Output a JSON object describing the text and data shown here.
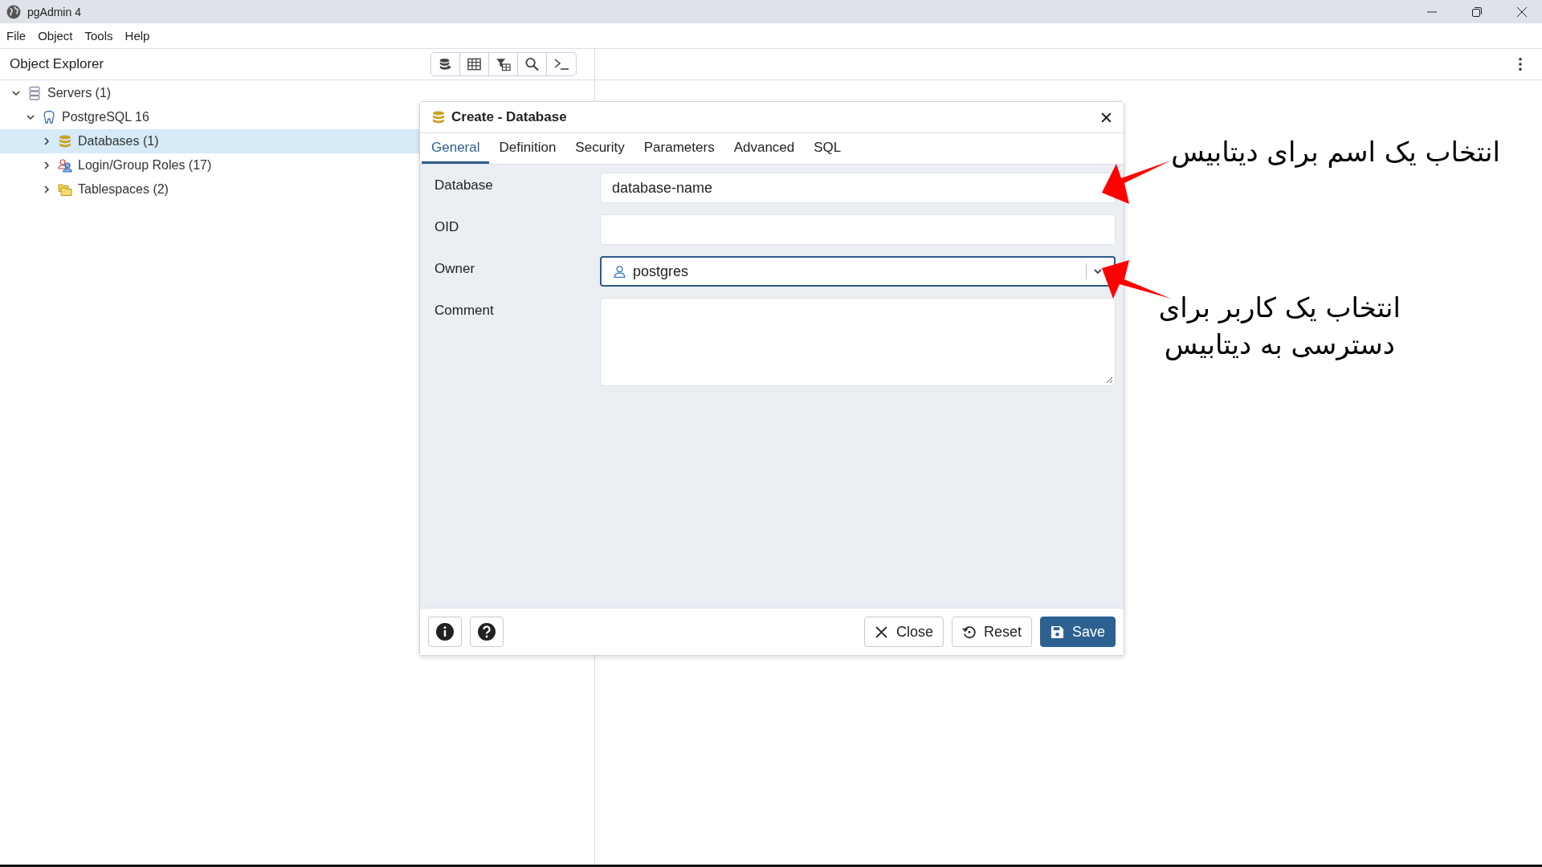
{
  "window": {
    "title": "pgAdmin 4"
  },
  "menu": [
    "File",
    "Object",
    "Tools",
    "Help"
  ],
  "explorer": {
    "title": "Object Explorer",
    "tree": [
      {
        "label": "Servers (1)",
        "kind": "servers",
        "expanded": true,
        "selected": false,
        "children": [
          {
            "label": "PostgreSQL 16",
            "kind": "server",
            "expanded": true,
            "selected": false,
            "children": [
              {
                "label": "Databases (1)",
                "kind": "databases",
                "expanded": false,
                "selected": true
              },
              {
                "label": "Login/Group Roles (17)",
                "kind": "roles",
                "expanded": false,
                "selected": false
              },
              {
                "label": "Tablespaces (2)",
                "kind": "tablespaces",
                "expanded": false,
                "selected": false
              }
            ]
          }
        ]
      }
    ]
  },
  "dialog": {
    "title": "Create - Database",
    "tabs": [
      {
        "label": "General",
        "selected": true
      },
      {
        "label": "Definition",
        "selected": false
      },
      {
        "label": "Security",
        "selected": false
      },
      {
        "label": "Parameters",
        "selected": false
      },
      {
        "label": "Advanced",
        "selected": false
      },
      {
        "label": "SQL",
        "selected": false
      }
    ],
    "fields": [
      {
        "kind": "text",
        "label": "Database",
        "value": "database-name",
        "focused": false
      },
      {
        "kind": "text",
        "label": "OID",
        "focused": false
      },
      {
        "kind": "select",
        "label": "Owner",
        "value": "postgres",
        "focused": true
      },
      {
        "kind": "textarea",
        "label": "Comment",
        "focused": false
      }
    ],
    "buttons": [
      {
        "kind": "close",
        "label": "Close"
      },
      {
        "kind": "reset",
        "label": "Reset"
      },
      {
        "kind": "save",
        "label": "Save"
      }
    ]
  },
  "annotations": [
    {
      "lines": [
        "انتخاب یک اسم برای دیتابیس"
      ]
    },
    {
      "lines": [
        "انتخاب یک کاربر برای",
        "دسترسی به دیتابیس"
      ]
    }
  ]
}
